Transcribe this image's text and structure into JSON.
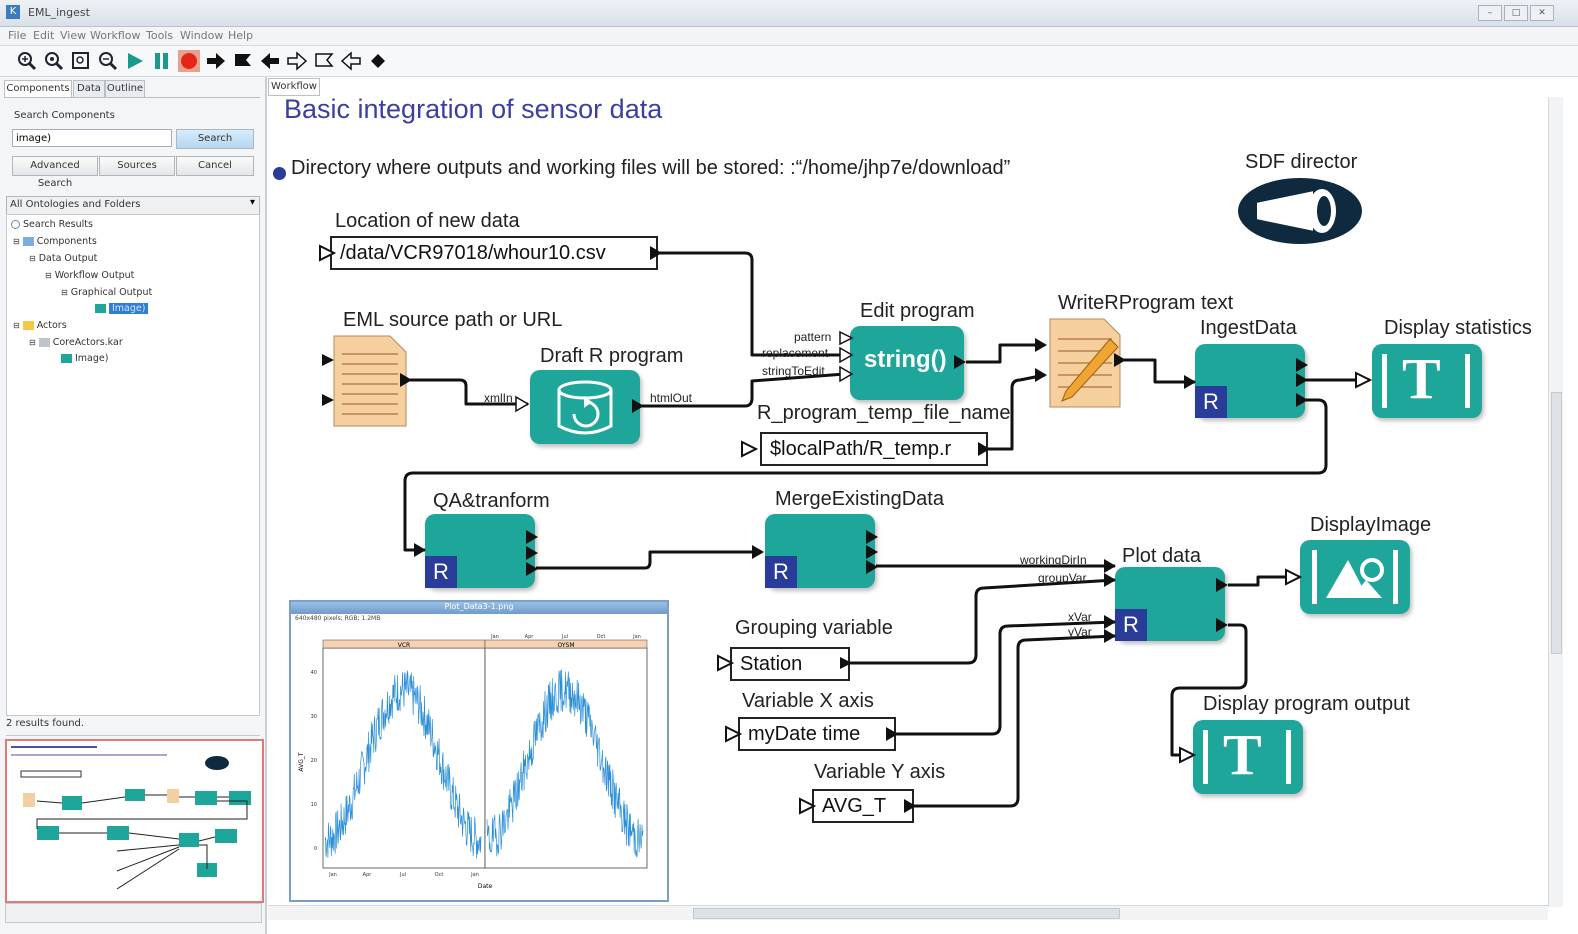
{
  "window": {
    "title": "EML_ingest",
    "app_icon": "K"
  },
  "menu": [
    "File",
    "Edit",
    "View",
    "Workflow",
    "Tools",
    "Window",
    "Help"
  ],
  "toolbar_icons": [
    "zoom-in-icon",
    "zoom-reset-icon",
    "zoom-fit-icon",
    "zoom-out-icon",
    "run-icon",
    "pause-icon",
    "stop-icon",
    "step-arrow-icon",
    "flag-icon",
    "arrow-left-icon",
    "port-outline-icon",
    "port-outline-2-icon",
    "port-outline-3-icon",
    "diamond-icon"
  ],
  "left_panel": {
    "tabs": [
      "Components",
      "Data",
      "Outline"
    ],
    "search_label": "Search Components",
    "search_value": "image)",
    "search_button": "Search",
    "advanced_button": "Advanced Search",
    "sources_button": "Sources",
    "cancel_button": "Cancel",
    "ontology_select": "All Ontologies and Folders",
    "tree": [
      {
        "label": "Search Results",
        "depth": 0
      },
      {
        "label": "Components",
        "depth": 1
      },
      {
        "label": "Data Output",
        "depth": 2
      },
      {
        "label": "Workflow Output",
        "depth": 3
      },
      {
        "label": "Graphical Output",
        "depth": 4
      },
      {
        "label": "Image)",
        "depth": 5,
        "selected": true
      },
      {
        "label": "Actors",
        "depth": 1
      },
      {
        "label": "CoreActors.kar",
        "depth": 2
      },
      {
        "label": "Image)",
        "depth": 3
      }
    ],
    "results_count": "2 results found."
  },
  "workflow": {
    "tab_label": "Workflow",
    "title": "Basic integration of sensor data",
    "directory_note": "Directory where outputs and working files will be stored: :“/home/jhp7e/download”",
    "director_label": "SDF director",
    "params": {
      "location_label": "Location of new data",
      "location_value": "/data/VCR97018/whour10.csv",
      "temp_label": "R_program_temp_file_name",
      "temp_value": "$localPath/R_temp.r",
      "group_label": "Grouping variable",
      "group_value": "Station",
      "xaxis_label": "Variable X axis",
      "xaxis_value": "myDate time",
      "yaxis_label": "Variable Y axis",
      "yaxis_value": "AVG_T"
    },
    "actors": {
      "eml_source": "EML source path or URL",
      "draft_r": "Draft R program",
      "edit_program": "Edit program",
      "edit_program_body": "string()",
      "write_r": "WriteRProgram text",
      "ingest": "IngestData",
      "display_stats": "Display statistics",
      "qa": "QA&tranform",
      "merge": "MergeExistingData",
      "plot": "Plot data",
      "display_image": "DisplayImage",
      "display_output": "Display program output",
      "r_badge": "R",
      "t_glyph": "T"
    },
    "ports": {
      "xmlin": "xmlIn",
      "htmlout": "htmlOut",
      "pattern": "pattern",
      "replacement": "replacement",
      "stringtoedit": "stringToEdit",
      "workingdir": "workingDirIn",
      "groupvar": "groupVar",
      "xvar": "xVar",
      "yvar": "yVar"
    }
  },
  "plot_window": {
    "title": "Plot_Data3-1.png",
    "info": "640x480 pixels; RGB; 1.2MB",
    "panel_left": "VCR",
    "panel_right": "OYSM",
    "x_label": "Date",
    "y_label": "AVG_T",
    "x_ticks": [
      "Jan",
      "Apr",
      "Jul",
      "Oct",
      "Jan"
    ],
    "y_ticks": [
      "0",
      "10",
      "20",
      "30",
      "40"
    ]
  }
}
